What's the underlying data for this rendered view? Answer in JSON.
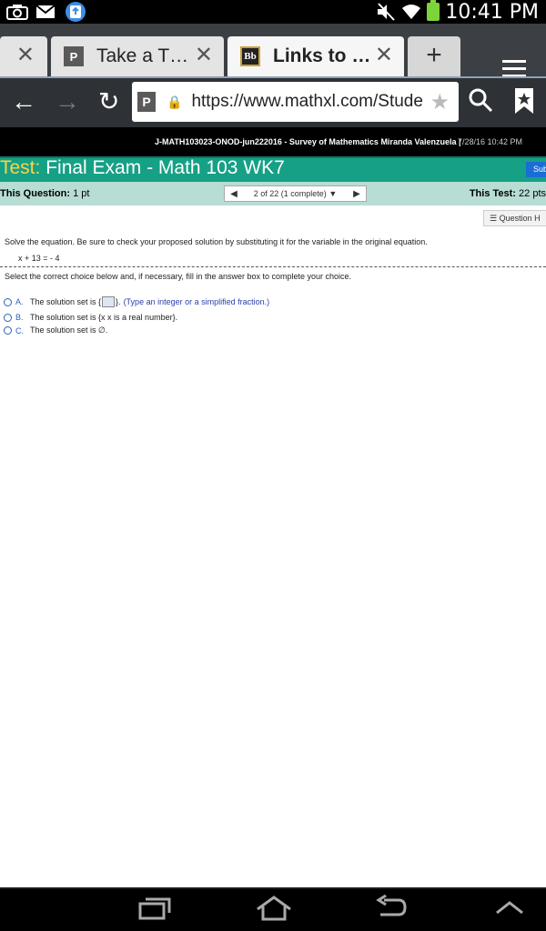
{
  "status_bar": {
    "time": "10:41 PM",
    "icons": [
      "camera-icon",
      "mail-icon",
      "upload-icon",
      "mute-icon",
      "wifi-icon",
      "battery-icon"
    ]
  },
  "browser": {
    "tabs": [
      {
        "title": "",
        "active": false
      },
      {
        "title": "Take a T…",
        "favicon": "P",
        "active": false
      },
      {
        "title": "Links to …",
        "favicon": "Bb",
        "active": true
      }
    ],
    "new_tab_label": "+",
    "url": "https://www.mathxl.com/Stude"
  },
  "page": {
    "course": "J-MATH103023-ONOD-jun222016 - Survey of Mathematics",
    "student": "Miranda Valenzuela",
    "date": "7/28/16 10:42 PM",
    "test_label": "Test:",
    "test_title": "Final Exam - Math 103 WK7",
    "submit_label": "Sub",
    "this_question_label": "This Question:",
    "this_question_value": "1 pt",
    "pager_position": "2 of 22 (1 complete)",
    "this_test_label": "This Test:",
    "this_test_value": "22 pts",
    "question_help_label": "Question H",
    "instructions": "Solve the equation.  Be sure to check your proposed solution by substituting it for the variable in the original equation.",
    "equation": "x + 13 = - 4",
    "select_text": "Select the correct choice below and, if necessary, fill in the answer box to complete your choice.",
    "choices": [
      {
        "letter": "A.",
        "before": "The solution set is {",
        "after": "}.",
        "hint": "(Type an integer or a simplified fraction.)"
      },
      {
        "letter": "B.",
        "text": "The solution set is {x  x is a real number}."
      },
      {
        "letter": "C.",
        "text": "The solution set is ∅."
      }
    ]
  }
}
